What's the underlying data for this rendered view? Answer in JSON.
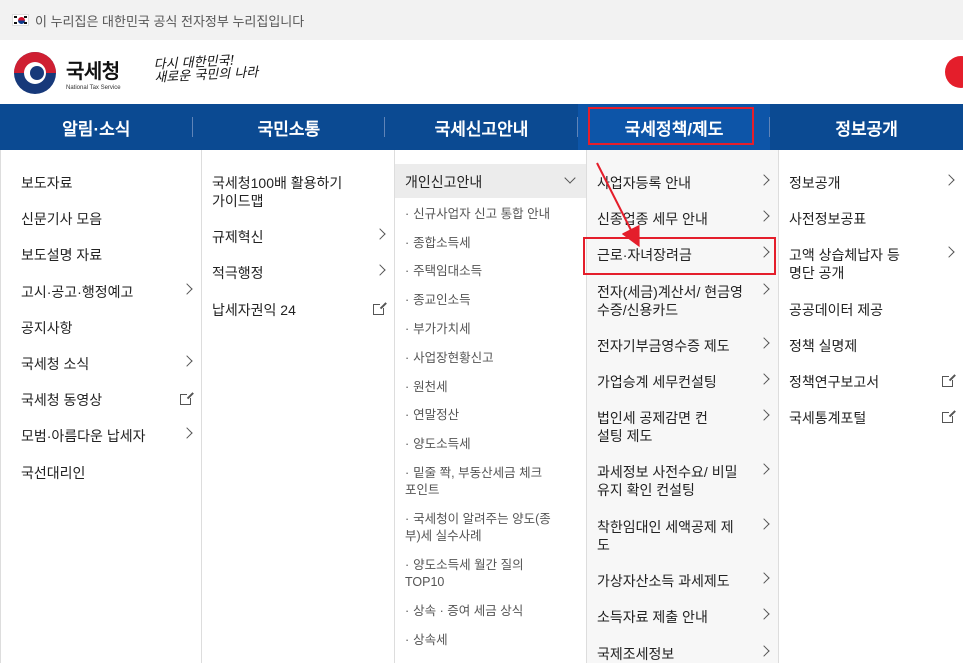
{
  "gov_banner": {
    "text": "이 누리집은 대한민국 공식 전자정부 누리집입니다"
  },
  "logo": {
    "name_ko": "국세청",
    "name_en": "National Tax Service"
  },
  "slogan": {
    "line1": "다시 대한민국!",
    "line2": "새로운 국민의 나라"
  },
  "colors": {
    "nav_bg": "#0b4a92",
    "highlight": "#e41e2b",
    "brand_blue": "#17397a",
    "brand_red": "#cf1f32"
  },
  "gnb": [
    {
      "label": "알림·소식"
    },
    {
      "label": "국민소통"
    },
    {
      "label": "국세신고안내"
    },
    {
      "label": "국세정책/제도"
    },
    {
      "label": "정보공개"
    }
  ],
  "col1": [
    {
      "label": "보도자료",
      "icon": ""
    },
    {
      "label": "신문기사 모음",
      "icon": ""
    },
    {
      "label": "보도설명 자료",
      "icon": ""
    },
    {
      "label": "고시·공고·행정예고",
      "icon": "chevron-right-icon"
    },
    {
      "label": "공지사항",
      "icon": ""
    },
    {
      "label": "국세청 소식",
      "icon": "chevron-right-icon"
    },
    {
      "label": "국세청 동영상",
      "icon": "external-link-icon"
    },
    {
      "label": "모범·아름다운 납세자",
      "icon": "chevron-right-icon"
    },
    {
      "label": "국선대리인",
      "icon": ""
    }
  ],
  "col2": [
    {
      "label": "국세청100배 활용하기 가이드맵",
      "icon": ""
    },
    {
      "label": "규제혁신",
      "icon": "chevron-right-icon"
    },
    {
      "label": "적극행정",
      "icon": "chevron-right-icon"
    },
    {
      "label": "납세자권익 24",
      "icon": "external-link-icon"
    }
  ],
  "col3": {
    "header": "개인신고안내",
    "items": [
      "신규사업자 신고 통합 안내",
      "종합소득세",
      "주택임대소득",
      "종교인소득",
      "부가가치세",
      "사업장현황신고",
      "원천세",
      "연말정산",
      "양도소득세",
      "밑줄 쫙, 부동산세금 체크포인트",
      "국세청이 알려주는 양도(종부)세 실수사례",
      "양도소득세 월간 질의 TOP10",
      "상속 · 증여 세금 상식",
      "상속세"
    ]
  },
  "col4": [
    {
      "label": "사업자등록 안내"
    },
    {
      "label": "신종업종 세무 안내"
    },
    {
      "label": "근로·자녀장려금"
    },
    {
      "label": "전자(세금)계산서/ 현금영수증/신용카드"
    },
    {
      "label": "전자기부금영수증 제도"
    },
    {
      "label": "가업승계 세무컨설팅"
    },
    {
      "label": "법인세 공제감면 컨설팅 제도"
    },
    {
      "label": "과세정보 사전수요/ 비밀유지 확인 컨설팅"
    },
    {
      "label": "착한임대인 세액공제 제도"
    },
    {
      "label": "가상자산소득 과세제도"
    },
    {
      "label": "소득자료 제출 안내"
    },
    {
      "label": "국제조세정보"
    }
  ],
  "col5": [
    {
      "label": "정보공개",
      "icon": "chevron-right-icon"
    },
    {
      "label": "사전정보공표",
      "icon": ""
    },
    {
      "label": "고액 상습체납자 등 명단 공개",
      "icon": "chevron-right-icon"
    },
    {
      "label": "공공데이터 제공",
      "icon": ""
    },
    {
      "label": "정책 실명제",
      "icon": ""
    },
    {
      "label": "정책연구보고서",
      "icon": "external-link-icon"
    },
    {
      "label": "국세통계포털",
      "icon": "external-link-icon"
    }
  ]
}
